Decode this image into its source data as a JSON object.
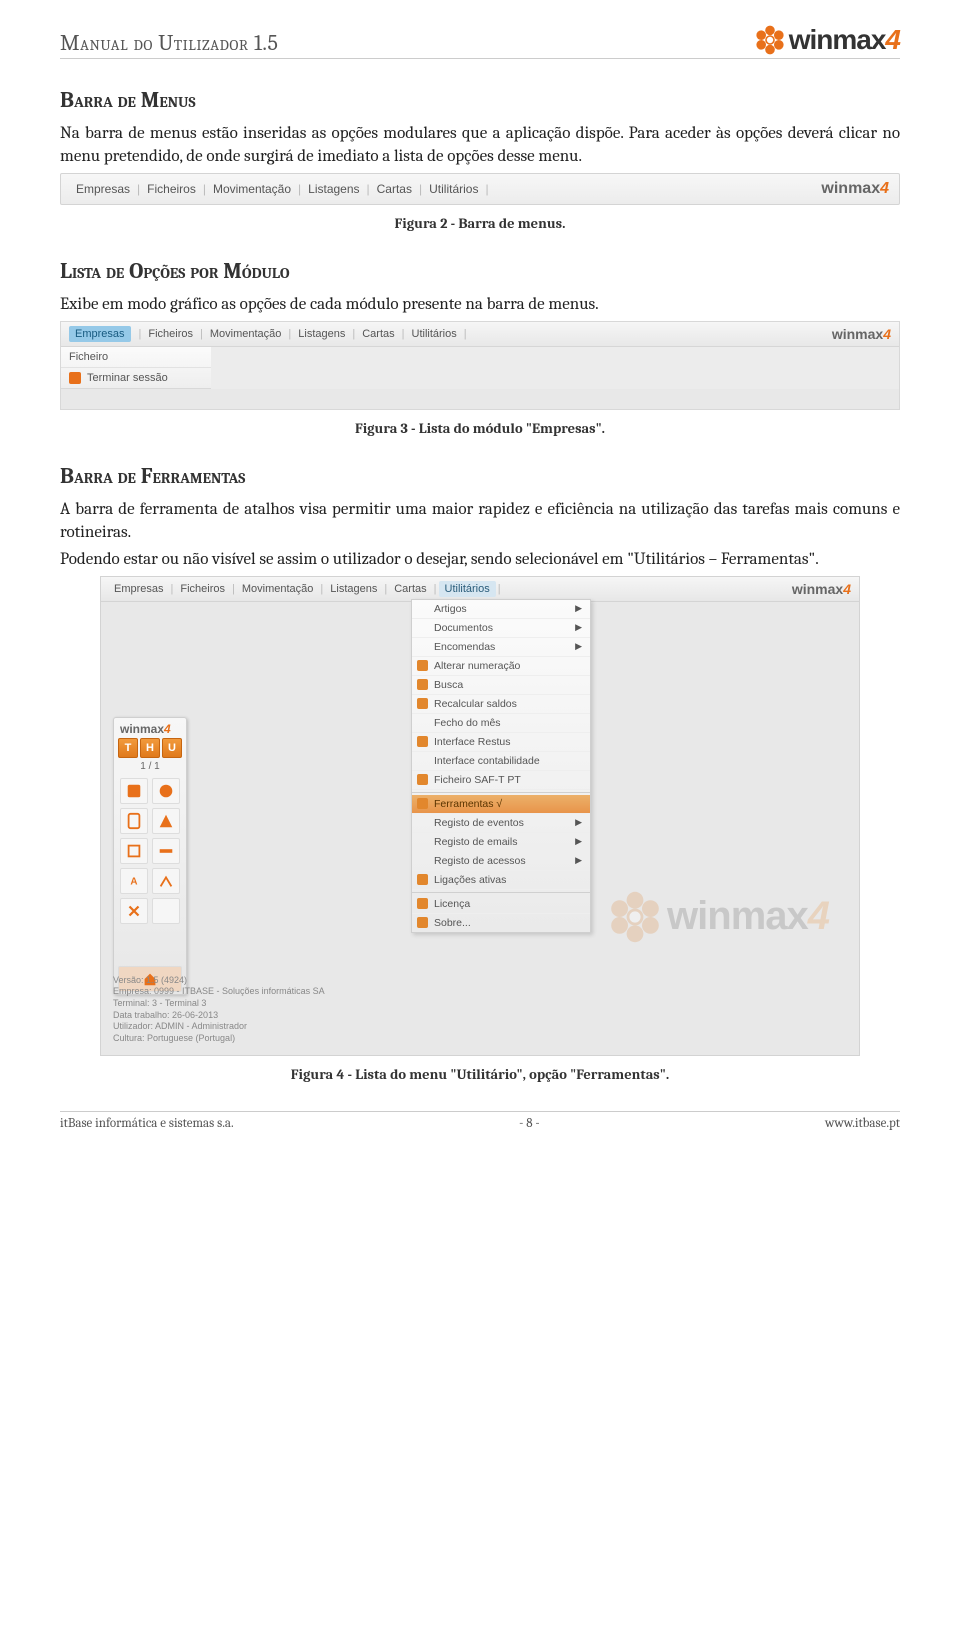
{
  "header": {
    "title": "Manual do Utilizador 1.5",
    "brand": "winmax",
    "brand_suffix": "4"
  },
  "section1": {
    "heading": "Barra de Menus",
    "para": "Na barra de menus estão inseridas as opções modulares que a aplicação dispõe. Para aceder às opções deverá clicar no menu pretendido, de onde surgirá de imediato a lista de opções desse menu."
  },
  "fig2": {
    "menu": [
      "Empresas",
      "Ficheiros",
      "Movimentação",
      "Listagens",
      "Cartas",
      "Utilitários"
    ],
    "caption": "Figura 2 - Barra de menus."
  },
  "section2": {
    "heading": "Lista de Opções por Módulo",
    "para": "Exibe em modo gráfico as opções de cada módulo presente na barra de menus."
  },
  "fig3": {
    "menu_active": "Empresas",
    "menu_rest": [
      "Ficheiros",
      "Movimentação",
      "Listagens",
      "Cartas",
      "Utilitários"
    ],
    "drop": [
      "Ficheiro",
      "Terminar sessão"
    ],
    "caption": "Figura 3 - Lista do módulo \"Empresas\"."
  },
  "section3": {
    "heading": "Barra de Ferramentas",
    "para1": "A barra de ferramenta de atalhos visa permitir uma maior rapidez e eficiência na utilização das tarefas mais comuns e rotineiras.",
    "para2": "Podendo estar ou não visível se assim o utilizador o desejar, sendo selecionável em \"Utilitários – Ferramentas\"."
  },
  "fig4": {
    "menu": [
      "Empresas",
      "Ficheiros",
      "Movimentação",
      "Listagens",
      "Cartas"
    ],
    "menu_active": "Utilitários",
    "dropdown_top": [
      {
        "label": "Artigos",
        "arrow": true
      },
      {
        "label": "Documentos",
        "arrow": true
      },
      {
        "label": "Encomendas",
        "arrow": true
      },
      {
        "label": "Alterar numeração",
        "icon": true
      },
      {
        "label": "Busca",
        "icon": true
      },
      {
        "label": "Recalcular saldos",
        "icon": true
      },
      {
        "label": "Fecho do mês"
      },
      {
        "label": "Interface Restus",
        "icon": true
      },
      {
        "label": "Interface contabilidade"
      },
      {
        "label": "Ficheiro SAF-T PT",
        "icon": true
      }
    ],
    "dropdown_hl": {
      "label": "Ferramentas √",
      "icon": true
    },
    "dropdown_mid": [
      {
        "label": "Registo de eventos",
        "arrow": true
      },
      {
        "label": "Registo de emails",
        "arrow": true
      },
      {
        "label": "Registo de acessos",
        "arrow": true
      },
      {
        "label": "Ligações ativas",
        "icon": true
      }
    ],
    "dropdown_bot": [
      {
        "label": "Licença",
        "icon": true
      },
      {
        "label": "Sobre...",
        "icon": true
      }
    ],
    "toolbar": {
      "brand": "winmax",
      "brand_suffix": "4",
      "squares": [
        "T",
        "H",
        "U"
      ],
      "counter": "1 / 1"
    },
    "footinfo": [
      "Versão: 1.5 (4924)",
      "Empresa: 0999 - ITBASE - Soluções informáticas SA",
      "Terminal: 3 - Terminal 3",
      "Data trabalho: 26-06-2013",
      "Utilizador: ADMIN - Administrador",
      "Cultura: Portuguese (Portugal)"
    ],
    "caption": "Figura 4 - Lista do menu \"Utilitário\", opção \"Ferramentas\"."
  },
  "footer": {
    "left": "itBase informática e sistemas s.a.",
    "center": "- 8 -",
    "right": "www.itbase.pt"
  }
}
